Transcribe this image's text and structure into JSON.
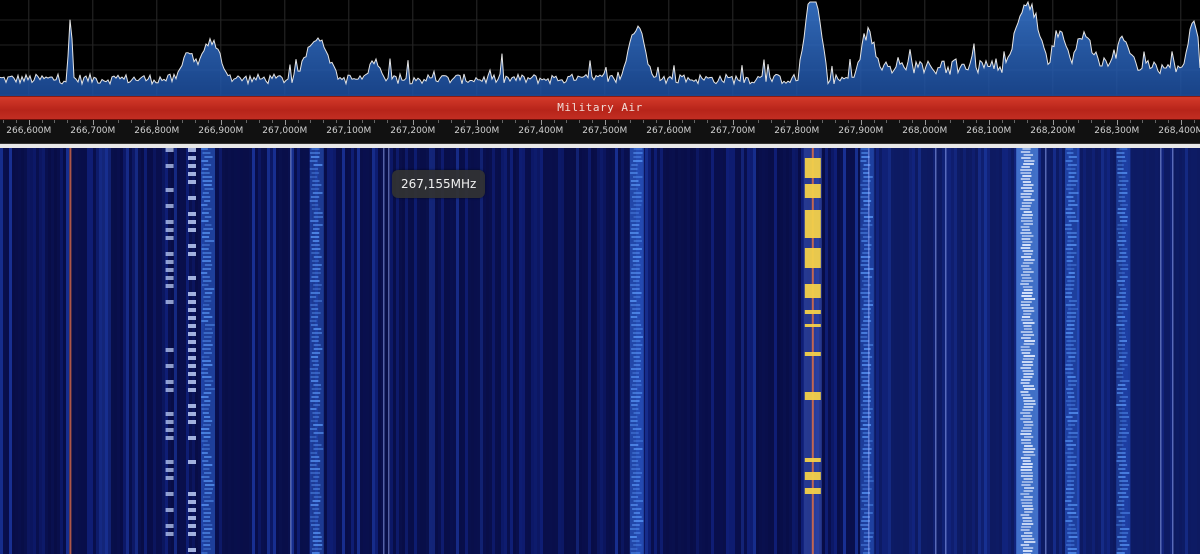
{
  "band_plan": {
    "label": "Military Air",
    "color": "#c52b1f"
  },
  "frequency_axis": {
    "labels": [
      "266,600M",
      "266,700M",
      "266,800M",
      "266,900M",
      "267,000M",
      "267,100M",
      "267,200M",
      "267,300M",
      "267,400M",
      "267,500M",
      "267,600M",
      "267,700M",
      "267,800M",
      "267,900M",
      "268,000M",
      "268,100M",
      "268,200M",
      "268,300M",
      "268,400M"
    ],
    "start_mhz": 266.555,
    "end_mhz": 268.43
  },
  "tooltip": {
    "text": "267,155MHz"
  },
  "colors": {
    "spectrum_fill": "#1d4fa0",
    "spectrum_line": "#e6e6e6",
    "waterfall_background": "#06093b",
    "signal_hot": "#f2d04a",
    "signal_cool": "#5fa0ff",
    "carrier_line": "#d46a4a"
  },
  "waterfall": {
    "signals": [
      {
        "freq_mhz": 266.665,
        "kind": "carrier",
        "intensity": 0.8
      },
      {
        "freq_mhz": 266.82,
        "kind": "burst",
        "intensity": 0.7
      },
      {
        "freq_mhz": 266.855,
        "kind": "burst",
        "intensity": 0.8
      },
      {
        "freq_mhz": 266.88,
        "kind": "wide",
        "intensity": 0.6
      },
      {
        "freq_mhz": 267.05,
        "kind": "wide",
        "intensity": 0.55
      },
      {
        "freq_mhz": 267.55,
        "kind": "wide",
        "intensity": 0.7
      },
      {
        "freq_mhz": 267.825,
        "kind": "hot",
        "intensity": 1.0
      },
      {
        "freq_mhz": 267.91,
        "kind": "wide",
        "intensity": 0.5
      },
      {
        "freq_mhz": 268.16,
        "kind": "bright",
        "intensity": 0.9
      },
      {
        "freq_mhz": 268.23,
        "kind": "wide",
        "intensity": 0.55
      },
      {
        "freq_mhz": 268.31,
        "kind": "wide",
        "intensity": 0.45
      }
    ]
  }
}
